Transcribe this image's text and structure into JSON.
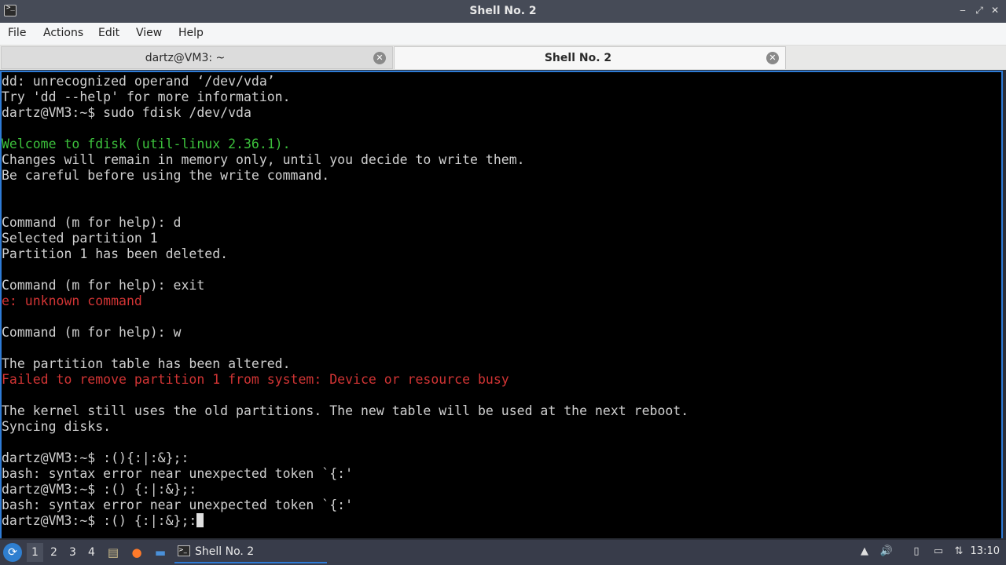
{
  "window": {
    "title": "Shell No. 2",
    "minimize": "‒",
    "restore": "⤢",
    "close": "✕"
  },
  "menu": [
    "File",
    "Actions",
    "Edit",
    "View",
    "Help"
  ],
  "tabs": [
    {
      "label": "dartz@VM3: ~",
      "active": false
    },
    {
      "label": "Shell No. 2",
      "active": true
    }
  ],
  "terminal": {
    "lines": [
      {
        "text": "dd: unrecognized operand ‘/dev/vda’",
        "color": "default"
      },
      {
        "text": "Try 'dd --help' for more information.",
        "color": "default"
      },
      {
        "text": "dartz@VM3:~$ sudo fdisk /dev/vda",
        "color": "default"
      },
      {
        "text": "",
        "color": "default"
      },
      {
        "text": "Welcome to fdisk (util-linux 2.36.1).",
        "color": "green"
      },
      {
        "text": "Changes will remain in memory only, until you decide to write them.",
        "color": "default"
      },
      {
        "text": "Be careful before using the write command.",
        "color": "default"
      },
      {
        "text": "",
        "color": "default"
      },
      {
        "text": "",
        "color": "default"
      },
      {
        "text": "Command (m for help): d",
        "color": "default"
      },
      {
        "text": "Selected partition 1",
        "color": "default"
      },
      {
        "text": "Partition 1 has been deleted.",
        "color": "default"
      },
      {
        "text": "",
        "color": "default"
      },
      {
        "text": "Command (m for help): exit",
        "color": "default"
      },
      {
        "text": "e: unknown command",
        "color": "red"
      },
      {
        "text": "",
        "color": "default"
      },
      {
        "text": "Command (m for help): w",
        "color": "default"
      },
      {
        "text": "",
        "color": "default"
      },
      {
        "text": "The partition table has been altered.",
        "color": "default"
      },
      {
        "text": "Failed to remove partition 1 from system: Device or resource busy",
        "color": "red"
      },
      {
        "text": "",
        "color": "default"
      },
      {
        "text": "The kernel still uses the old partitions. The new table will be used at the next reboot.",
        "color": "default"
      },
      {
        "text": "Syncing disks.",
        "color": "default"
      },
      {
        "text": "",
        "color": "default"
      },
      {
        "text": "dartz@VM3:~$ :(){:|:&};:",
        "color": "default"
      },
      {
        "text": "bash: syntax error near unexpected token `{:'",
        "color": "default"
      },
      {
        "text": "dartz@VM3:~$ :() {:|:&};:",
        "color": "default"
      },
      {
        "text": "bash: syntax error near unexpected token `{:'",
        "color": "default"
      }
    ],
    "prompt_line": "dartz@VM3:~$ :() {:|:&};:"
  },
  "taskbar": {
    "workspaces": [
      "1",
      "2",
      "3",
      "4"
    ],
    "active_workspace": "1",
    "launchers": [
      "file-manager-icon",
      "firefox-icon",
      "show-desktop-icon"
    ],
    "task_label": "Shell No. 2",
    "tray_icons": [
      "hardware-icon",
      "volume-icon",
      "clipboard-icon",
      "monitor-icon",
      "network-icon"
    ],
    "clock": "13:10"
  },
  "colors": {
    "accent": "#2e7bd6",
    "terminal_bg": "#000000",
    "green_text": "#3cc13c",
    "red_text": "#d13434"
  }
}
